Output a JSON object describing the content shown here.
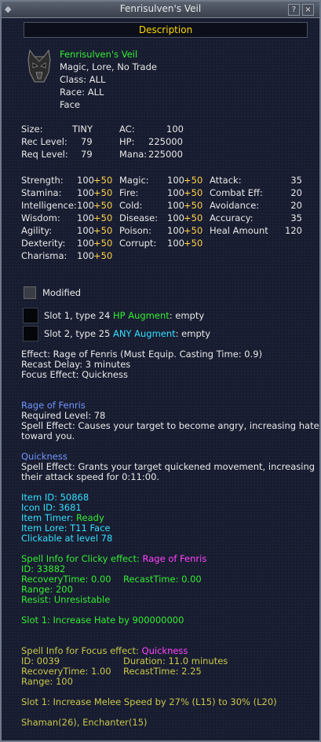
{
  "window": {
    "title": "Fenrisulven's Veil",
    "help_label": "?",
    "close_label": "×",
    "corner_label": "◆"
  },
  "description_header": "Description",
  "item": {
    "name": "Fenrisulven's Veil",
    "flags": "Magic, Lore, No Trade",
    "class_line": "Class:  ALL",
    "race_line": "Race:  ALL",
    "slot_line": "Face"
  },
  "stats_top": {
    "size_label": "Size:",
    "size_value": "TINY",
    "rec_label": "Rec Level:",
    "rec_value": "79",
    "req_label": "Req Level:",
    "req_value": "79",
    "ac_label": "AC:",
    "ac_value": "100",
    "hp_label": "HP:",
    "hp_value": "225000",
    "mana_label": "Mana:",
    "mana_value": "225000"
  },
  "attributes": [
    {
      "label": "Strength:",
      "base": "100",
      "bonus": "+50"
    },
    {
      "label": "Stamina:",
      "base": "100",
      "bonus": "+50"
    },
    {
      "label": "Intelligence:",
      "base": "100",
      "bonus": "+50"
    },
    {
      "label": "Wisdom:",
      "base": "100",
      "bonus": "+50"
    },
    {
      "label": "Agility:",
      "base": "100",
      "bonus": "+50"
    },
    {
      "label": "Dexterity:",
      "base": "100",
      "bonus": "+50"
    },
    {
      "label": "Charisma:",
      "base": "100",
      "bonus": "+50"
    }
  ],
  "resists": [
    {
      "label": "Magic:",
      "base": "100",
      "bonus": "+50"
    },
    {
      "label": "Fire:",
      "base": "100",
      "bonus": "+50"
    },
    {
      "label": "Cold:",
      "base": "100",
      "bonus": "+50"
    },
    {
      "label": "Disease:",
      "base": "100",
      "bonus": "+50"
    },
    {
      "label": "Poison:",
      "base": "100",
      "bonus": "+50"
    },
    {
      "label": "Corrupt:",
      "base": "100",
      "bonus": "+50"
    }
  ],
  "combat": [
    {
      "label": "Attack:",
      "value": "35"
    },
    {
      "label": "Combat Eff:",
      "value": "20"
    },
    {
      "label": "Avoidance:",
      "value": "20"
    },
    {
      "label": "Accuracy:",
      "value": "35"
    },
    {
      "label": "Heal Amount",
      "value": "120"
    }
  ],
  "modified_label": "Modified",
  "augments": [
    {
      "prefix": "Slot 1, type 24 ",
      "type": "HP Augment",
      "suffix": ": empty"
    },
    {
      "prefix": "Slot 2, type 25 ",
      "type": "ANY Augment",
      "suffix": ": empty"
    }
  ],
  "effects": {
    "effect_line": "Effect: Rage of Fenris (Must Equip. Casting Time: 0.9)",
    "recast_line": "Recast Delay: 3 minutes",
    "focus_line": "Focus Effect: Quickness"
  },
  "rage": {
    "title": "Rage of Fenris",
    "req_line": "Required Level: 78",
    "spell_line1": "Spell Effect: Causes your target to become angry, increasing hate",
    "spell_line2": "toward you."
  },
  "quickness": {
    "title": "Quickness",
    "spell_line1": "Spell Effect: Grants your target quickened movement, increasing",
    "spell_line2": "their attack speed for 0:11:00."
  },
  "item_info": {
    "id_line": "Item ID: 50868",
    "icon_line": "Icon ID: 3681",
    "timer_label": "Item Timer: ",
    "timer_value": "Ready",
    "lore_line": "Item Lore: T11 Face",
    "click_line": "Clickable at level 78"
  },
  "clicky": {
    "header_prefix": "Spell Info for Clicky effect: ",
    "header_spell": "Rage of Fenris",
    "id_line": "ID: 33882",
    "recovery_line": "RecoveryTime: 0.00",
    "recast_line": "RecastTime: 0.00",
    "range_line": "Range: 200",
    "resist_line": "Resist: Unresistable",
    "slot_line": "Slot 1: Increase Hate by 900000000"
  },
  "focus": {
    "header_prefix": "Spell Info for Focus effect: ",
    "header_spell": "Quickness",
    "id_line": "ID: 0039",
    "duration_line": "Duration: 11.0 minutes",
    "recovery_line": "RecoveryTime: 1.00",
    "recast_line": "RecastTime: 2.25",
    "range_line": "Range: 100",
    "slot_line": "Slot 1: Increase Melee Speed by 27% (L15) to 30% (L20)",
    "classes_line": "Shaman(26), Enchanter(15)"
  }
}
